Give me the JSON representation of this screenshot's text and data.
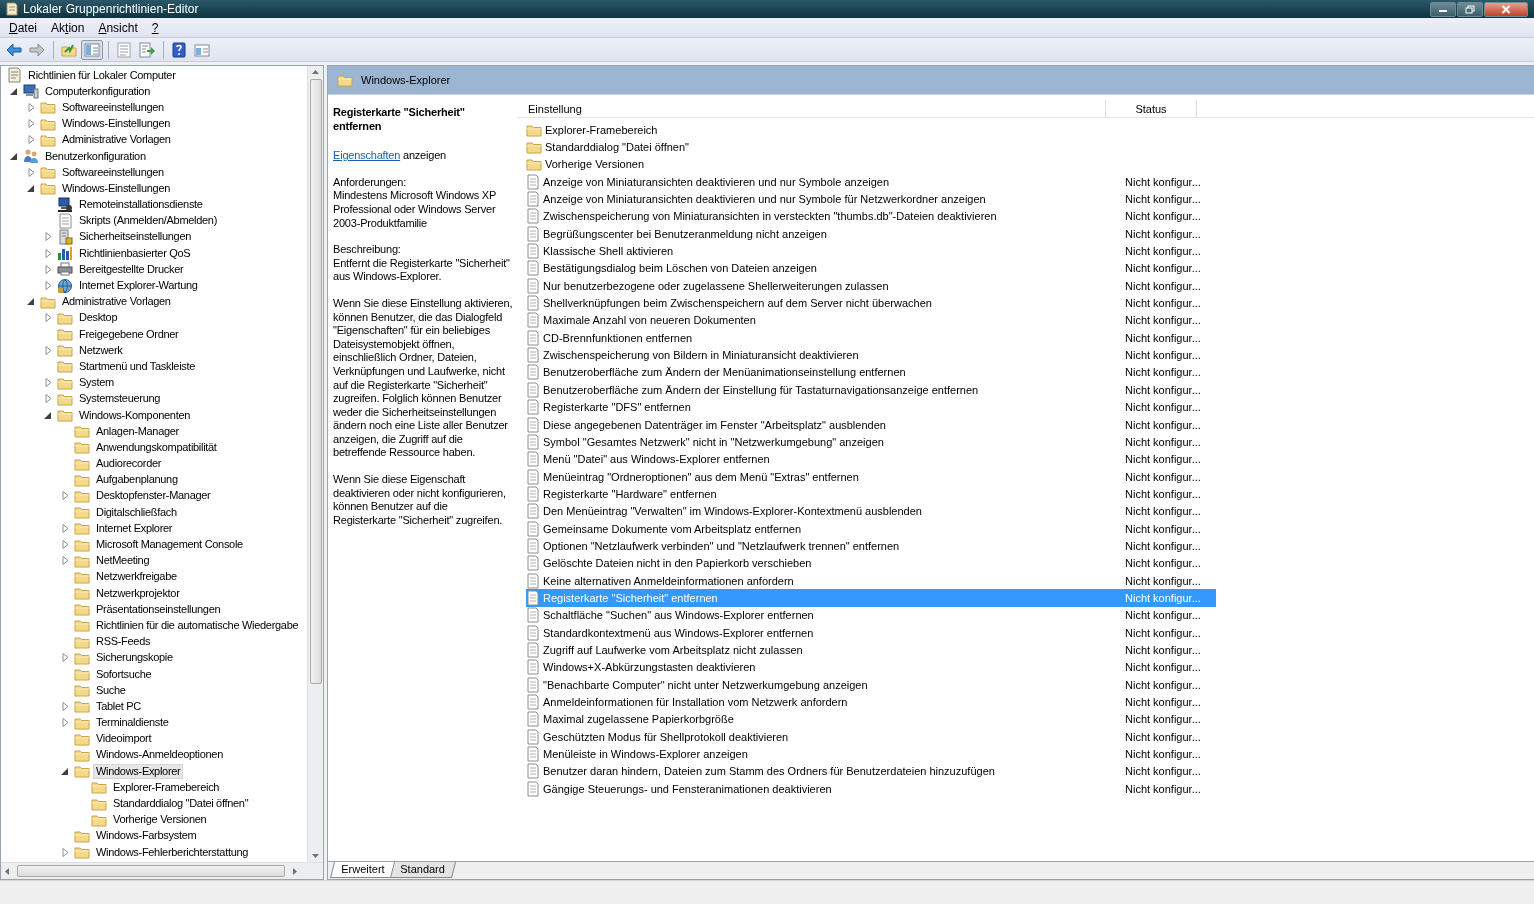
{
  "window": {
    "title": "Lokaler Gruppenrichtlinien-Editor"
  },
  "menu": [
    {
      "key": "D",
      "after": "atei"
    },
    {
      "before": "Ak",
      "key": "t",
      "after": "ion"
    },
    {
      "key": "A",
      "after": "nsicht"
    },
    {
      "key": "?"
    }
  ],
  "toolbar": {
    "groups": [
      [
        {
          "kind": "back",
          "disabled": false,
          "pressed": false
        },
        {
          "kind": "forward",
          "disabled": true,
          "pressed": false
        }
      ],
      [
        {
          "kind": "up",
          "disabled": false,
          "pressed": false
        },
        {
          "kind": "tree",
          "disabled": false,
          "pressed": true
        }
      ],
      [
        {
          "kind": "properties",
          "disabled": true,
          "pressed": false
        },
        {
          "kind": "export",
          "disabled": false,
          "pressed": false
        }
      ],
      [
        {
          "kind": "help",
          "disabled": false,
          "pressed": false
        },
        {
          "kind": "view",
          "disabled": false,
          "pressed": false
        }
      ]
    ]
  },
  "tree": [
    {
      "label": "Richtlinien für Lokaler Computer",
      "kind": "policy",
      "selected": false,
      "children": [
        {
          "label": "Computerkonfiguration",
          "kind": "computer",
          "expanded": true,
          "selected": false,
          "children": [
            {
              "label": "Softwareeinstellungen",
              "kind": "folder",
              "expanded": false,
              "selected": false
            },
            {
              "label": "Windows-Einstellungen",
              "kind": "folder",
              "expanded": false,
              "selected": false
            },
            {
              "label": "Administrative Vorlagen",
              "kind": "folder",
              "expanded": false,
              "selected": false
            }
          ]
        },
        {
          "label": "Benutzerkonfiguration",
          "kind": "users",
          "expanded": true,
          "selected": false,
          "children": [
            {
              "label": "Softwareeinstellungen",
              "kind": "folder",
              "expanded": false,
              "selected": false
            },
            {
              "label": "Windows-Einstellungen",
              "kind": "folder",
              "expanded": true,
              "selected": false,
              "children": [
                {
                  "label": "Remoteinstallationsdienste",
                  "kind": "remote",
                  "selected": false
                },
                {
                  "label": "Skripts (Anmelden/Abmelden)",
                  "kind": "script",
                  "selected": false
                },
                {
                  "label": "Sicherheitseinstellungen",
                  "kind": "security",
                  "expanded": false,
                  "selected": false
                },
                {
                  "label": "Richtlinienbasierter QoS",
                  "kind": "chart",
                  "expanded": false,
                  "selected": false
                },
                {
                  "label": "Bereitgestellte Drucker",
                  "kind": "printer",
                  "expanded": false,
                  "selected": false
                },
                {
                  "label": "Internet Explorer-Wartung",
                  "kind": "globe",
                  "expanded": false,
                  "selected": false
                }
              ]
            },
            {
              "label": "Administrative Vorlagen",
              "kind": "folder",
              "expanded": true,
              "selected": false,
              "children": [
                {
                  "label": "Desktop",
                  "kind": "folder",
                  "expanded": false,
                  "selected": false
                },
                {
                  "label": "Freigegebene Ordner",
                  "kind": "folder",
                  "selected": false
                },
                {
                  "label": "Netzwerk",
                  "kind": "folder",
                  "expanded": false,
                  "selected": false
                },
                {
                  "label": "Startmenü und Taskleiste",
                  "kind": "folder",
                  "selected": false
                },
                {
                  "label": "System",
                  "kind": "folder",
                  "expanded": false,
                  "selected": false
                },
                {
                  "label": "Systemsteuerung",
                  "kind": "folder",
                  "expanded": false,
                  "selected": false
                },
                {
                  "label": "Windows-Komponenten",
                  "kind": "folder",
                  "expanded": true,
                  "selected": false,
                  "children": [
                    {
                      "label": "Anlagen-Manager",
                      "kind": "folder",
                      "selected": false
                    },
                    {
                      "label": "Anwendungskompatibilität",
                      "kind": "folder",
                      "selected": false
                    },
                    {
                      "label": "Audiorecorder",
                      "kind": "folder",
                      "selected": false
                    },
                    {
                      "label": "Aufgabenplanung",
                      "kind": "folder",
                      "selected": false
                    },
                    {
                      "label": "Desktopfenster-Manager",
                      "kind": "folder",
                      "expanded": false,
                      "selected": false
                    },
                    {
                      "label": "Digitalschließfach",
                      "kind": "folder",
                      "selected": false
                    },
                    {
                      "label": "Internet Explorer",
                      "kind": "folder",
                      "expanded": false,
                      "selected": false
                    },
                    {
                      "label": "Microsoft Management Console",
                      "kind": "folder",
                      "expanded": false,
                      "selected": false
                    },
                    {
                      "label": "NetMeeting",
                      "kind": "folder",
                      "expanded": false,
                      "selected": false
                    },
                    {
                      "label": "Netzwerkfreigabe",
                      "kind": "folder",
                      "selected": false
                    },
                    {
                      "label": "Netzwerkprojektor",
                      "kind": "folder",
                      "selected": false
                    },
                    {
                      "label": "Präsentationseinstellungen",
                      "kind": "folder",
                      "selected": false
                    },
                    {
                      "label": "Richtlinien für die automatische Wiedergabe",
                      "kind": "folder",
                      "selected": false
                    },
                    {
                      "label": "RSS-Feeds",
                      "kind": "folder",
                      "selected": false
                    },
                    {
                      "label": "Sicherungskopie",
                      "kind": "folder",
                      "expanded": false,
                      "selected": false
                    },
                    {
                      "label": "Sofortsuche",
                      "kind": "folder",
                      "selected": false
                    },
                    {
                      "label": "Suche",
                      "kind": "folder",
                      "selected": false
                    },
                    {
                      "label": "Tablet PC",
                      "kind": "folder",
                      "expanded": false,
                      "selected": false
                    },
                    {
                      "label": "Terminaldienste",
                      "kind": "folder",
                      "expanded": false,
                      "selected": false
                    },
                    {
                      "label": "Videoimport",
                      "kind": "folder",
                      "selected": false
                    },
                    {
                      "label": "Windows-Anmeldeoptionen",
                      "kind": "folder",
                      "selected": false
                    },
                    {
                      "label": "Windows-Explorer",
                      "kind": "folder",
                      "expanded": true,
                      "selected": true,
                      "children": [
                        {
                          "label": "Explorer-Framebereich",
                          "kind": "folder",
                          "selected": false
                        },
                        {
                          "label": "Standarddialog \"Datei öffnen\"",
                          "kind": "folder",
                          "selected": false
                        },
                        {
                          "label": "Vorherige Versionen",
                          "kind": "folder",
                          "selected": false
                        }
                      ]
                    },
                    {
                      "label": "Windows-Farbsystem",
                      "kind": "folder",
                      "selected": false
                    },
                    {
                      "label": "Windows-Fehlerberichterstattung",
                      "kind": "folder",
                      "expanded": false,
                      "selected": false
                    }
                  ]
                }
              ]
            }
          ]
        }
      ]
    }
  ],
  "details": {
    "header": {
      "title": "Windows-Explorer"
    },
    "description": {
      "title": "Registerkarte \"Sicherheit\" entfernen",
      "link": "Eigenschaften",
      "link_suffix": " anzeigen",
      "paragraphs": [
        "Anforderungen:\nMindestens Microsoft Windows XP Professional oder Windows Server 2003-Produktfamilie",
        "Beschreibung:\nEntfernt die Registerkarte \"Sicherheit\" aus Windows-Explorer.",
        "Wenn Sie diese Einstellung aktivieren, können Benutzer, die das Dialogfeld \"Eigenschaften\" für ein beliebiges Dateisystemobjekt öffnen, einschließlich Ordner, Dateien, Verknüpfungen und Laufwerke, nicht auf die Registerkarte \"Sicherheit\" zugreifen. Folglich können Benutzer weder die Sicherheitseinstellungen ändern noch eine Liste aller Benutzer anzeigen, die Zugriff auf die betreffende Ressource haben.",
        "Wenn Sie diese Eigenschaft deaktivieren oder nicht konfigurieren, können Benutzer auf die Registerkarte \"Sicherheit\" zugreifen."
      ]
    },
    "columns": [
      {
        "label": "Einstellung"
      },
      {
        "label": "Status"
      }
    ],
    "rows": [
      {
        "kind": "folder",
        "name": "Explorer-Framebereich",
        "selected": false
      },
      {
        "kind": "folder",
        "name": "Standarddialog \"Datei öffnen\"",
        "selected": false
      },
      {
        "kind": "folder",
        "name": "Vorherige Versionen",
        "selected": false
      },
      {
        "kind": "setting",
        "name": "Anzeige von Miniaturansichten deaktivieren und nur Symbole anzeigen",
        "status": "Nicht konfigur...",
        "selected": false
      },
      {
        "kind": "setting",
        "name": "Anzeige von Miniaturansichten deaktivieren und nur Symbole für Netzwerkordner anzeigen",
        "status": "Nicht konfigur...",
        "selected": false
      },
      {
        "kind": "setting",
        "name": "Zwischenspeicherung von Miniaturansichten in versteckten \"thumbs.db\"-Dateien deaktivieren",
        "status": "Nicht konfigur...",
        "selected": false
      },
      {
        "kind": "setting",
        "name": "Begrüßungscenter bei Benutzeranmeldung nicht anzeigen",
        "status": "Nicht konfigur...",
        "selected": false
      },
      {
        "kind": "setting",
        "name": "Klassische Shell aktivieren",
        "status": "Nicht konfigur...",
        "selected": false
      },
      {
        "kind": "setting",
        "name": "Bestätigungsdialog beim Löschen von Dateien anzeigen",
        "status": "Nicht konfigur...",
        "selected": false
      },
      {
        "kind": "setting",
        "name": "Nur benutzerbezogene oder zugelassene Shellerweiterungen zulassen",
        "status": "Nicht konfigur...",
        "selected": false
      },
      {
        "kind": "setting",
        "name": "Shellverknüpfungen beim Zwischenspeichern auf dem Server nicht überwachen",
        "status": "Nicht konfigur...",
        "selected": false
      },
      {
        "kind": "setting",
        "name": "Maximale Anzahl von neueren Dokumenten",
        "status": "Nicht konfigur...",
        "selected": false
      },
      {
        "kind": "setting",
        "name": "CD-Brennfunktionen entfernen",
        "status": "Nicht konfigur...",
        "selected": false
      },
      {
        "kind": "setting",
        "name": "Zwischenspeicherung von Bildern in Miniaturansicht deaktivieren",
        "status": "Nicht konfigur...",
        "selected": false
      },
      {
        "kind": "setting",
        "name": "Benutzeroberfläche zum Ändern der Menüanimationseinstellung entfernen",
        "status": "Nicht konfigur...",
        "selected": false
      },
      {
        "kind": "setting",
        "name": "Benutzeroberfläche zum Ändern der Einstellung für Tastaturnavigationsanzeige entfernen",
        "status": "Nicht konfigur...",
        "selected": false
      },
      {
        "kind": "setting",
        "name": "Registerkarte \"DFS\" entfernen",
        "status": "Nicht konfigur...",
        "selected": false
      },
      {
        "kind": "setting",
        "name": "Diese angegebenen Datenträger im Fenster \"Arbeitsplatz\" ausblenden",
        "status": "Nicht konfigur...",
        "selected": false
      },
      {
        "kind": "setting",
        "name": "Symbol \"Gesamtes Netzwerk\" nicht in \"Netzwerkumgebung\" anzeigen",
        "status": "Nicht konfigur...",
        "selected": false
      },
      {
        "kind": "setting",
        "name": "Menü \"Datei\" aus Windows-Explorer entfernen",
        "status": "Nicht konfigur...",
        "selected": false
      },
      {
        "kind": "setting",
        "name": "Menüeintrag \"Ordneroptionen\" aus dem Menü \"Extras\" entfernen",
        "status": "Nicht konfigur...",
        "selected": false
      },
      {
        "kind": "setting",
        "name": "Registerkarte \"Hardware\" entfernen",
        "status": "Nicht konfigur...",
        "selected": false
      },
      {
        "kind": "setting",
        "name": "Den Menüeintrag \"Verwalten\" im Windows-Explorer-Kontextmenü ausblenden",
        "status": "Nicht konfigur...",
        "selected": false
      },
      {
        "kind": "setting",
        "name": "Gemeinsame Dokumente vom Arbeitsplatz entfernen",
        "status": "Nicht konfigur...",
        "selected": false
      },
      {
        "kind": "setting",
        "name": "Optionen \"Netzlaufwerk verbinden\" und \"Netzlaufwerk trennen\" entfernen",
        "status": "Nicht konfigur...",
        "selected": false
      },
      {
        "kind": "setting",
        "name": "Gelöschte Dateien nicht in den Papierkorb verschieben",
        "status": "Nicht konfigur...",
        "selected": false
      },
      {
        "kind": "setting",
        "name": "Keine alternativen Anmeldeinformationen anfordern",
        "status": "Nicht konfigur...",
        "selected": false
      },
      {
        "kind": "setting",
        "name": "Registerkarte \"Sicherheit\" entfernen",
        "status": "Nicht konfigur...",
        "selected": true
      },
      {
        "kind": "setting",
        "name": "Schaltfläche \"Suchen\" aus Windows-Explorer entfernen",
        "status": "Nicht konfigur...",
        "selected": false
      },
      {
        "kind": "setting",
        "name": "Standardkontextmenü aus Windows-Explorer entfernen",
        "status": "Nicht konfigur...",
        "selected": false
      },
      {
        "kind": "setting",
        "name": "Zugriff auf Laufwerke vom Arbeitsplatz nicht zulassen",
        "status": "Nicht konfigur...",
        "selected": false
      },
      {
        "kind": "setting",
        "name": "Windows+X-Abkürzungstasten deaktivieren",
        "status": "Nicht konfigur...",
        "selected": false
      },
      {
        "kind": "setting",
        "name": "\"Benachbarte Computer\" nicht unter Netzwerkumgebung anzeigen",
        "status": "Nicht konfigur...",
        "selected": false
      },
      {
        "kind": "setting",
        "name": "Anmeldeinformationen für Installation vom Netzwerk anfordern",
        "status": "Nicht konfigur...",
        "selected": false
      },
      {
        "kind": "setting",
        "name": "Maximal zugelassene Papierkorbgröße",
        "status": "Nicht konfigur...",
        "selected": false
      },
      {
        "kind": "setting",
        "name": "Geschützten Modus für Shellprotokoll deaktivieren",
        "status": "Nicht konfigur...",
        "selected": false
      },
      {
        "kind": "setting",
        "name": "Menüleiste in Windows-Explorer anzeigen",
        "status": "Nicht konfigur...",
        "selected": false
      },
      {
        "kind": "setting",
        "name": "Benutzer daran hindern, Dateien zum Stamm des Ordners für Benutzerdateien hinzuzufügen",
        "status": "Nicht konfigur...",
        "selected": false
      },
      {
        "kind": "setting",
        "name": "Gängige Steuerungs- und Fensteranimationen deaktivieren",
        "status": "Nicht konfigur...",
        "selected": false
      }
    ],
    "tabs": [
      {
        "label": "Erweitert",
        "selected": true
      },
      {
        "label": "Standard",
        "selected": false
      }
    ]
  }
}
